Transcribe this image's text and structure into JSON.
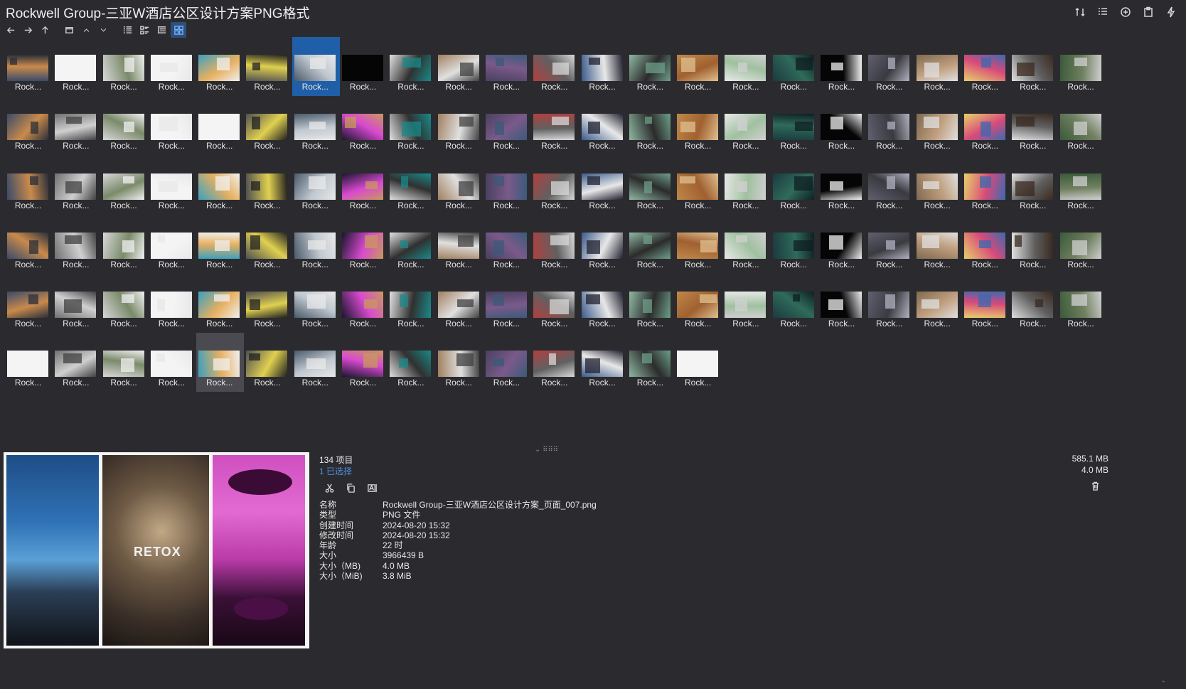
{
  "window": {
    "title": "Rockwell Group-三亚W酒店公区设计方案PNG格式"
  },
  "grid": {
    "item_label": "Rock...",
    "selected_index": 6,
    "hover_index": 119,
    "total_visible": 130
  },
  "info": {
    "item_count": "134 项目",
    "selected_count": "1 已选择",
    "total_size": "585.1 MB",
    "selected_size": "4.0 MB",
    "properties": [
      {
        "key": "名称",
        "value": "Rockwell Group-三亚W酒店公区设计方案_页面_007.png"
      },
      {
        "key": "类型",
        "value": "PNG 文件"
      },
      {
        "key": "创建时间",
        "value": "2024-08-20  15:32"
      },
      {
        "key": "修改时间",
        "value": "2024-08-20  15:32"
      },
      {
        "key": "年龄",
        "value": "22 时"
      },
      {
        "key": "大小",
        "value": "3966439 B"
      },
      {
        "key": "大小（MB)",
        "value": "4.0 MB"
      },
      {
        "key": "大小（MiB)",
        "value": "3.8 MiB"
      }
    ]
  },
  "preview": {
    "overlay_text": "RETOX"
  },
  "icons": {
    "top_right": [
      "sort-icon",
      "details-list-icon",
      "add-icon",
      "clipboard-icon",
      "flash-icon"
    ],
    "toolbar": [
      "back-icon",
      "forward-icon",
      "up-icon",
      "window-icon",
      "chevron-up-icon",
      "chevron-down-icon",
      "list-view-icon",
      "details-view-icon",
      "tree-view-icon",
      "grid-view-icon"
    ],
    "actions": [
      "cut-icon",
      "copy-icon",
      "rename-icon"
    ]
  },
  "colors": {
    "background": "#2b2b2f",
    "selection": "#1f5fa8",
    "accent": "#4d8fe0"
  }
}
